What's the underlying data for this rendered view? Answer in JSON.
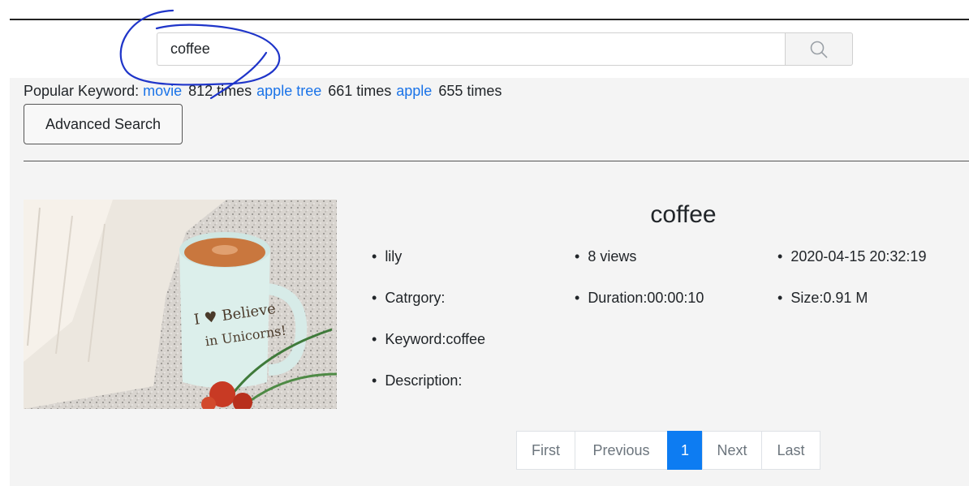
{
  "search": {
    "query": "coffee",
    "button_icon": "search-icon"
  },
  "popular": {
    "label": "Popular Keyword:",
    "keywords": [
      {
        "term": "movie",
        "count": "812 times"
      },
      {
        "term": "apple tree",
        "count": "661 times"
      },
      {
        "term": "apple",
        "count": "655 times"
      }
    ]
  },
  "advanced_search_label": "Advanced Search",
  "result": {
    "title": "coffee",
    "author": "lily",
    "views": "8 views",
    "date": "2020-04-15 20:32:19",
    "category": "Catrgory:",
    "duration": "Duration:00:00:10",
    "size": "Size:0.91 M",
    "keyword": "Keyword:coffee",
    "description": "Description:",
    "thumbnail_text": "I ♥ Believe in Unicorns!"
  },
  "pagination": {
    "first": "First",
    "previous": "Previous",
    "current": "1",
    "next": "Next",
    "last": "Last"
  },
  "colors": {
    "link": "#1a73e8",
    "active_page": "#0d7cf2",
    "annotation": "#1f35c9",
    "panel_bg": "#f4f4f4"
  }
}
